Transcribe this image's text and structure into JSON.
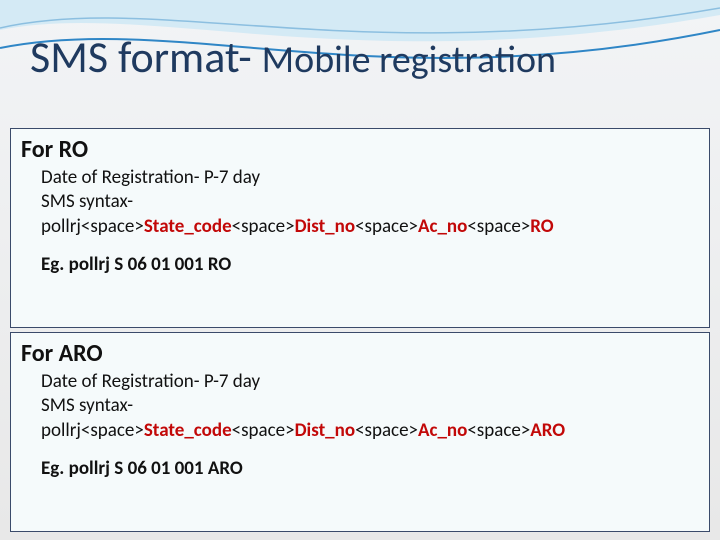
{
  "title": {
    "part1": "SMS format- ",
    "part2": "Mobile registration"
  },
  "sections": [
    {
      "heading": "For RO",
      "date_line": "Date of Registration-   P-7 day",
      "syntax_label": "SMS syntax-",
      "syntax_parts": [
        {
          "text": "pollrj<space>",
          "style": "plain"
        },
        {
          "text": "State_code",
          "style": "red"
        },
        {
          "text": "<space>",
          "style": "plain"
        },
        {
          "text": "Dist_no",
          "style": "red"
        },
        {
          "text": "<space>",
          "style": "plain"
        },
        {
          "text": "Ac_no",
          "style": "red"
        },
        {
          "text": "<space>",
          "style": "plain"
        },
        {
          "text": "RO",
          "style": "red"
        }
      ],
      "example": "Eg.   pollrj  S 06  01 001 RO"
    },
    {
      "heading": "For ARO",
      "date_line": "Date of Registration-   P-7 day",
      "syntax_label": "SMS syntax-",
      "syntax_parts": [
        {
          "text": "pollrj<space>",
          "style": "plain"
        },
        {
          "text": "State_code",
          "style": "red"
        },
        {
          "text": "<space>",
          "style": "plain"
        },
        {
          "text": "Dist_no",
          "style": "red"
        },
        {
          "text": "<space>",
          "style": "plain"
        },
        {
          "text": "Ac_no",
          "style": "red"
        },
        {
          "text": "<space>",
          "style": "plain"
        },
        {
          "text": "ARO",
          "style": "red"
        }
      ],
      "example": "Eg.  pollrj  S 06  01 001 ARO"
    }
  ]
}
